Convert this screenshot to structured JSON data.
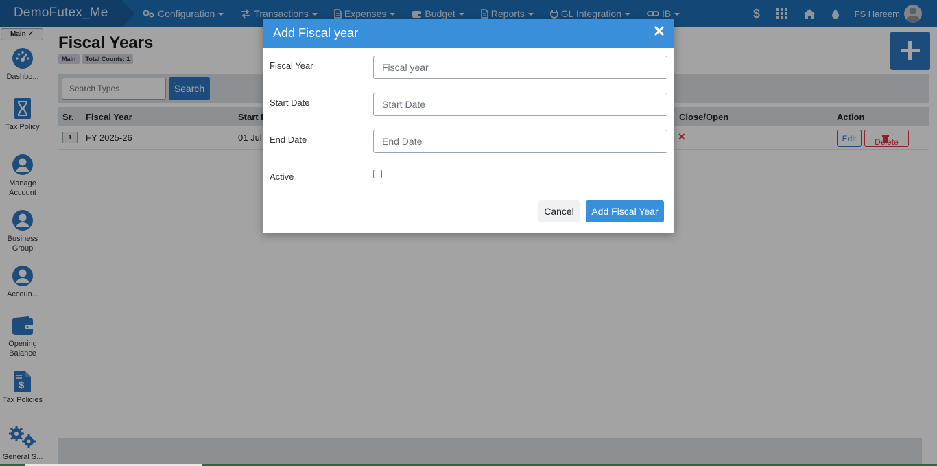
{
  "app": {
    "brand": "DemoFutex_Me",
    "user_name": "FS Hareem"
  },
  "nav": [
    {
      "label": "Configuration",
      "icon": "gears-icon"
    },
    {
      "label": "Transactions",
      "icon": "exchange-icon"
    },
    {
      "label": "Expenses",
      "icon": "document-icon"
    },
    {
      "label": "Budget",
      "icon": "wallet-icon"
    },
    {
      "label": "Reports",
      "icon": "document-icon"
    },
    {
      "label": "GL Integration",
      "icon": "plug-icon"
    },
    {
      "label": "IB",
      "icon": "link-icon"
    }
  ],
  "topright_icons": [
    "dollar-icon",
    "grid-icon",
    "home-icon",
    "drop-icon"
  ],
  "sidebar": {
    "toggle_label": "Main",
    "items": [
      {
        "label": "Dashbo...",
        "icon": "dashboard-icon"
      },
      {
        "label": "Tax Policy",
        "icon": "hourglass-icon"
      },
      {
        "label": "Manage Account",
        "icon": "user-circle-icon"
      },
      {
        "label": "Business Group",
        "icon": "user-circle-icon"
      },
      {
        "label": "Accoun...",
        "icon": "user-circle-icon"
      },
      {
        "label": "Opening Balance",
        "icon": "wallet-icon"
      },
      {
        "label": "Tax Policies",
        "icon": "invoice-dollar-icon"
      },
      {
        "label": "General S...",
        "icon": "gears-icon"
      }
    ]
  },
  "page": {
    "title": "Fiscal Years",
    "badge_main": "Main",
    "badge_count": "Total Counts: 1",
    "search_placeholder": "Search Types",
    "search_button": "Search"
  },
  "table": {
    "headers": {
      "sr": "Sr.",
      "fiscal_year": "Fiscal Year",
      "start_date": "Start D",
      "close_open": "Close/Open",
      "action": "Action"
    },
    "rows": [
      {
        "sr": "1",
        "fiscal_year": "FY 2025-26",
        "start_date": "01 Jul",
        "close_open": "✕",
        "edit": "Edit",
        "delete": "Delete"
      }
    ]
  },
  "modal": {
    "title": "Add Fiscal year",
    "fields": {
      "fiscal_year_label": "Fiscal Year",
      "fiscal_year_placeholder": "Fiscal year",
      "start_date_label": "Start Date",
      "start_date_placeholder": "Start Date",
      "end_date_label": "End Date",
      "end_date_placeholder": "End Date",
      "active_label": "Active"
    },
    "cancel_label": "Cancel",
    "submit_label": "Add Fiscal Year"
  },
  "colors": {
    "navbar": "#1f6fb8",
    "primary": "#2e77bf",
    "modal_header": "#3a8fdb",
    "danger": "#dc3545",
    "icon_blue": "#2e77bf"
  }
}
